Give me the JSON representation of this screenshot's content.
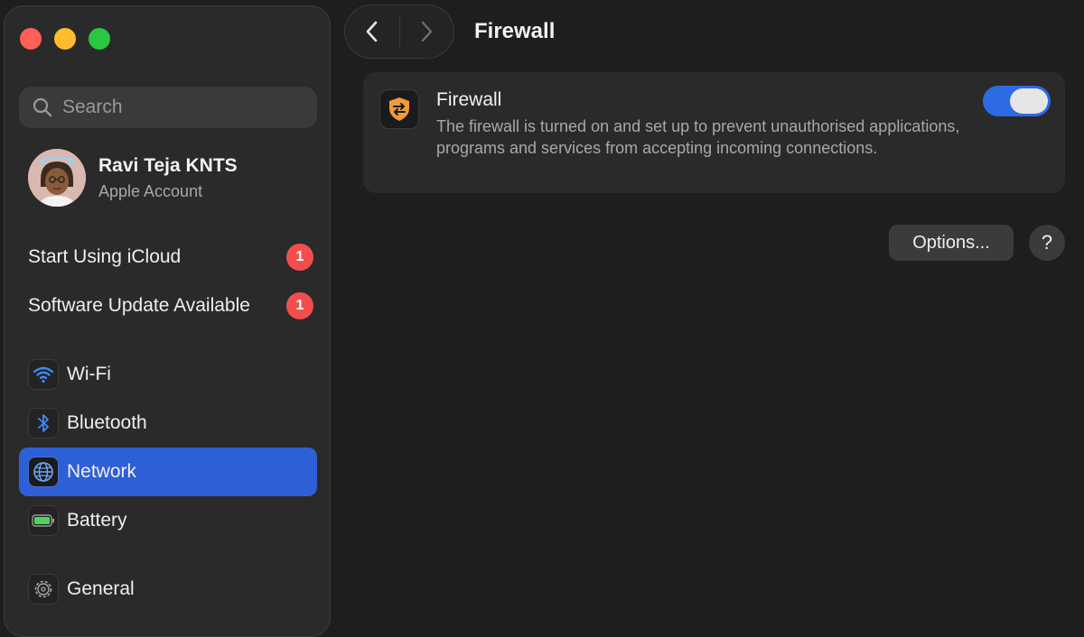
{
  "window": {
    "traffic_lights": [
      "close",
      "minimize",
      "zoom"
    ],
    "colors": {
      "close": "#fe5f57",
      "minimize": "#febc2e",
      "zoom": "#28c840",
      "accent": "#2d5fd6"
    }
  },
  "sidebar": {
    "search_placeholder": "Search",
    "account": {
      "name": "Ravi Teja KNTS",
      "subtitle": "Apple Account",
      "icon": "memoji-avatar"
    },
    "notices": [
      {
        "label": "Start Using iCloud",
        "badge": "1"
      },
      {
        "label": "Software Update Available",
        "badge": "1"
      }
    ],
    "items": [
      {
        "label": "Wi-Fi",
        "icon": "wifi-icon",
        "selected": false
      },
      {
        "label": "Bluetooth",
        "icon": "bluetooth-icon",
        "selected": false
      },
      {
        "label": "Network",
        "icon": "globe-icon",
        "selected": true
      },
      {
        "label": "Battery",
        "icon": "battery-icon",
        "selected": false
      },
      {
        "label": "General",
        "icon": "gear-icon",
        "selected": false
      }
    ]
  },
  "toolbar": {
    "back_icon": "chevron-left-icon",
    "forward_icon": "chevron-right-icon",
    "title": "Firewall"
  },
  "firewall_card": {
    "icon": "firewall-shield-icon",
    "title": "Firewall",
    "description": "The firewall is turned on and set up to prevent unauthorised applications, programs and services from accepting incoming connections.",
    "enabled": true
  },
  "buttons": {
    "options": "Options...",
    "help": "?"
  }
}
